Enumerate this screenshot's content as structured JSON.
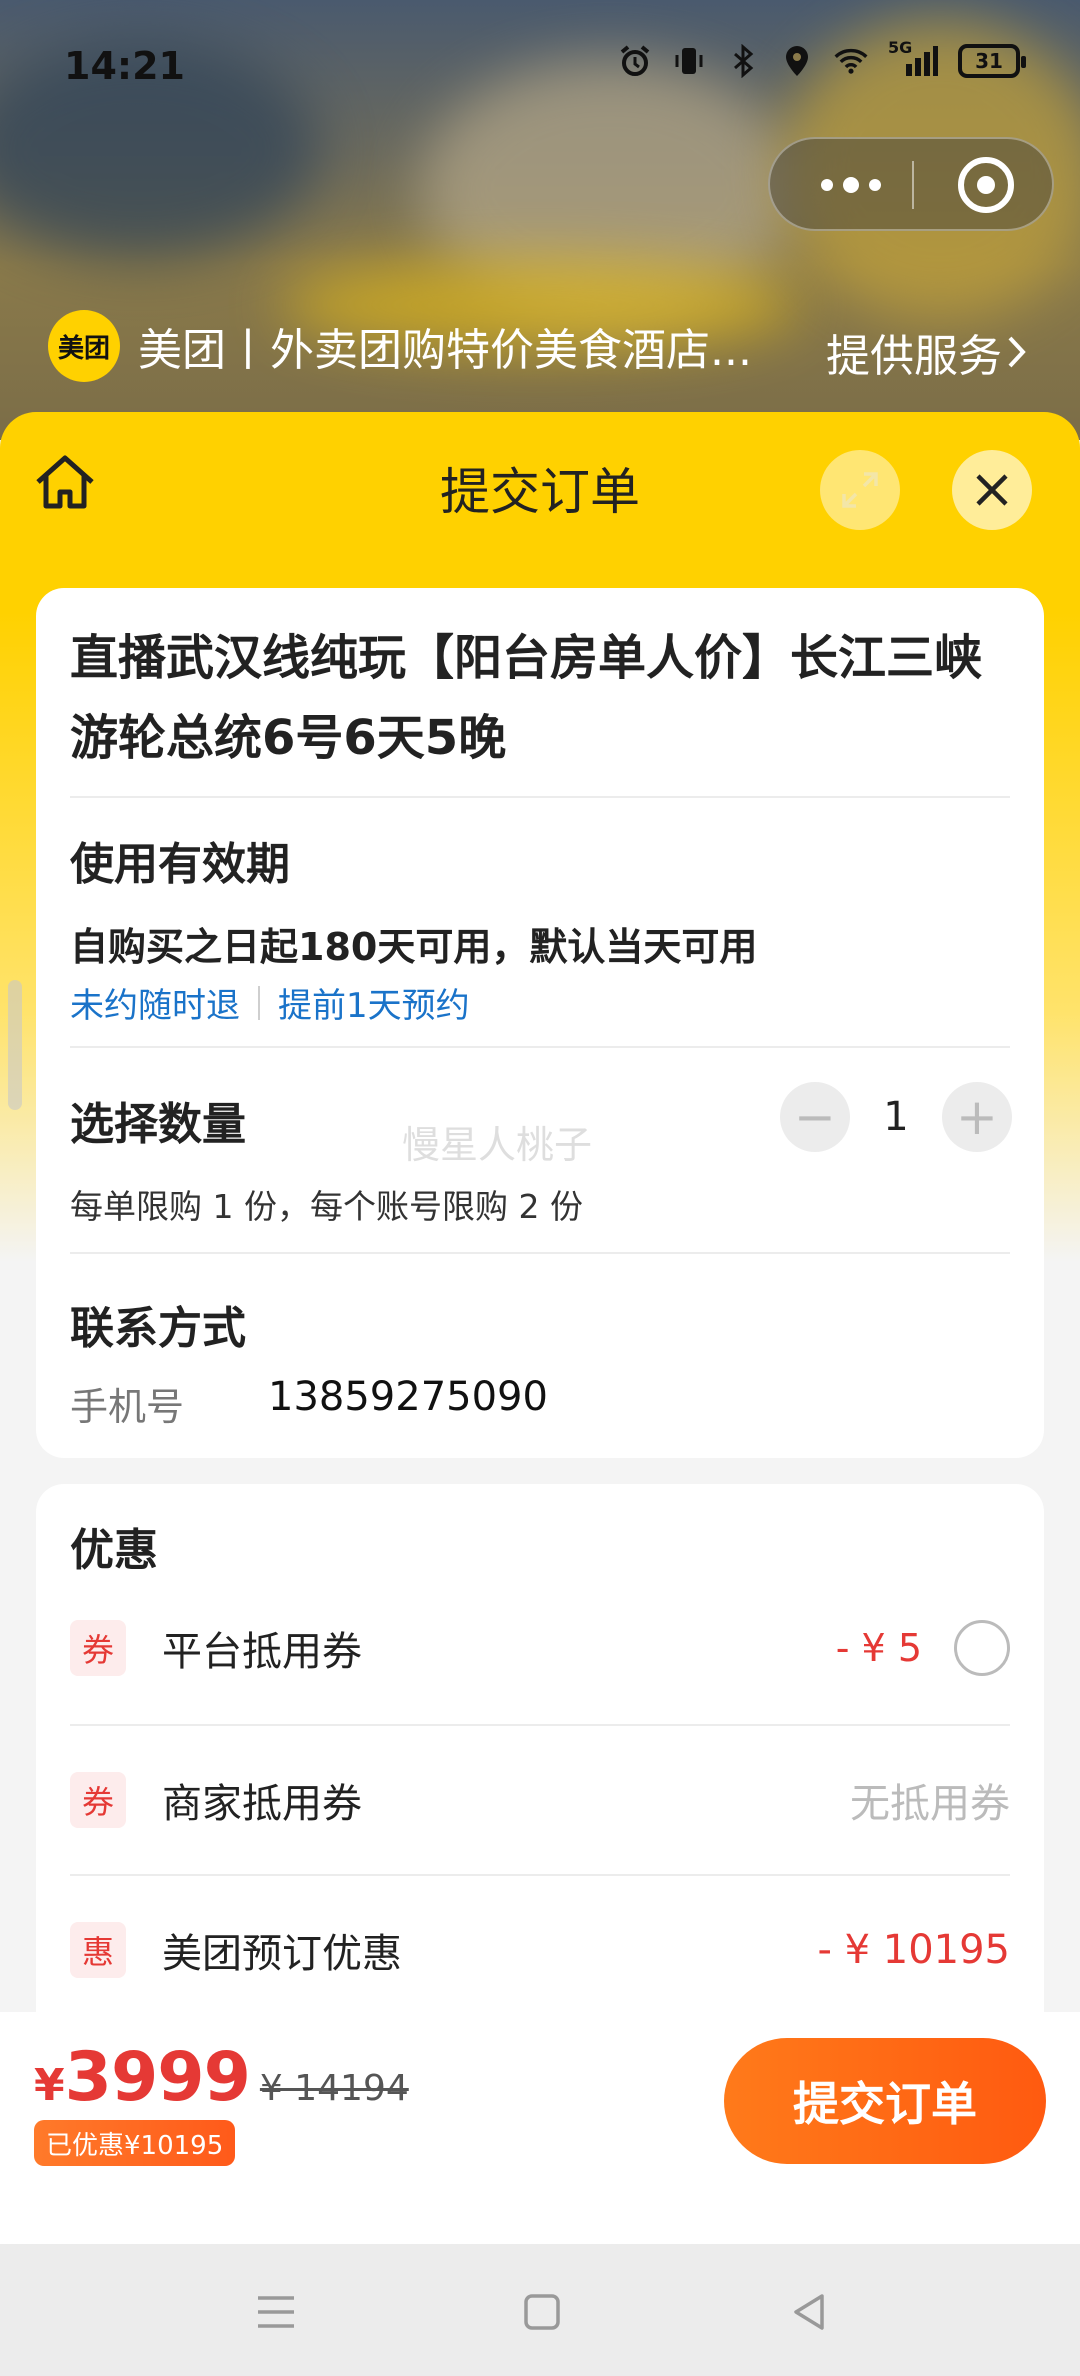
{
  "status_bar": {
    "time": "14:21",
    "network": "5G",
    "battery": "31",
    "icons": [
      "alarm-icon",
      "vibrate-icon",
      "bluetooth-icon",
      "location-icon",
      "wifi-icon",
      "signal-icon",
      "battery-icon"
    ]
  },
  "mini_program": {
    "logo_text": "美团",
    "name": "美团丨外卖团购特价美食酒店...",
    "service_label": "提供服务"
  },
  "sheet": {
    "title": "提交订单"
  },
  "product": {
    "title": "直播武汉线纯玩【阳台房单人价】长江三峡游轮总统6号6天5晚"
  },
  "validity": {
    "section_title": "使用有效期",
    "text": "自购买之日起180天可用，默认当天可用",
    "tags": [
      "未约随时退",
      "提前1天预约"
    ]
  },
  "quantity": {
    "section_title": "选择数量",
    "value": "1",
    "limit_text": "每单限购 1 份，每个账号限购 2 份",
    "watermark": "慢星人桃子"
  },
  "contact": {
    "section_title": "联系方式",
    "phone_label": "手机号",
    "phone_value": "13859275090"
  },
  "promotions": {
    "section_title": "优惠",
    "items": [
      {
        "badge": "券",
        "label": "平台抵用券",
        "value": "- ¥ 5"
      },
      {
        "badge": "券",
        "label": "商家抵用券",
        "value": "无抵用券"
      },
      {
        "badge": "惠",
        "label": "美团预订优惠",
        "value": "- ¥ 10195"
      }
    ]
  },
  "summary": {
    "currency": "¥",
    "price": "3999",
    "original_price": "¥ 14194",
    "saved_text": "已优惠¥10195",
    "submit_label": "提交订单"
  },
  "colors": {
    "brand_yellow": "#ffd100",
    "accent_red": "#e53935",
    "submit_orange": "#ff6a14",
    "link_blue": "#1a73c9"
  }
}
